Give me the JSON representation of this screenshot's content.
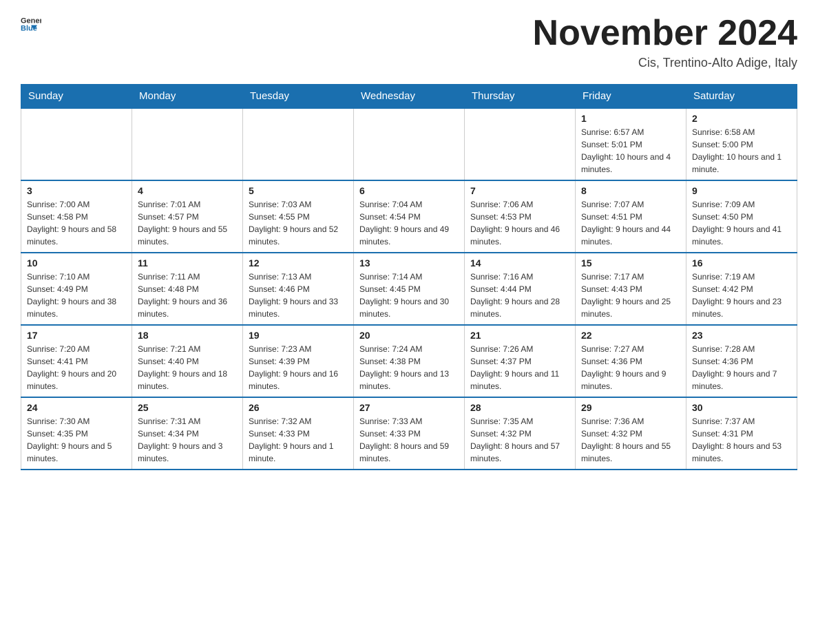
{
  "logo": {
    "text_general": "General",
    "text_blue": "Blue",
    "icon": "▶"
  },
  "header": {
    "month": "November 2024",
    "location": "Cis, Trentino-Alto Adige, Italy"
  },
  "days_of_week": [
    "Sunday",
    "Monday",
    "Tuesday",
    "Wednesday",
    "Thursday",
    "Friday",
    "Saturday"
  ],
  "weeks": [
    [
      {
        "day": "",
        "info": ""
      },
      {
        "day": "",
        "info": ""
      },
      {
        "day": "",
        "info": ""
      },
      {
        "day": "",
        "info": ""
      },
      {
        "day": "",
        "info": ""
      },
      {
        "day": "1",
        "info": "Sunrise: 6:57 AM\nSunset: 5:01 PM\nDaylight: 10 hours and 4 minutes."
      },
      {
        "day": "2",
        "info": "Sunrise: 6:58 AM\nSunset: 5:00 PM\nDaylight: 10 hours and 1 minute."
      }
    ],
    [
      {
        "day": "3",
        "info": "Sunrise: 7:00 AM\nSunset: 4:58 PM\nDaylight: 9 hours and 58 minutes."
      },
      {
        "day": "4",
        "info": "Sunrise: 7:01 AM\nSunset: 4:57 PM\nDaylight: 9 hours and 55 minutes."
      },
      {
        "day": "5",
        "info": "Sunrise: 7:03 AM\nSunset: 4:55 PM\nDaylight: 9 hours and 52 minutes."
      },
      {
        "day": "6",
        "info": "Sunrise: 7:04 AM\nSunset: 4:54 PM\nDaylight: 9 hours and 49 minutes."
      },
      {
        "day": "7",
        "info": "Sunrise: 7:06 AM\nSunset: 4:53 PM\nDaylight: 9 hours and 46 minutes."
      },
      {
        "day": "8",
        "info": "Sunrise: 7:07 AM\nSunset: 4:51 PM\nDaylight: 9 hours and 44 minutes."
      },
      {
        "day": "9",
        "info": "Sunrise: 7:09 AM\nSunset: 4:50 PM\nDaylight: 9 hours and 41 minutes."
      }
    ],
    [
      {
        "day": "10",
        "info": "Sunrise: 7:10 AM\nSunset: 4:49 PM\nDaylight: 9 hours and 38 minutes."
      },
      {
        "day": "11",
        "info": "Sunrise: 7:11 AM\nSunset: 4:48 PM\nDaylight: 9 hours and 36 minutes."
      },
      {
        "day": "12",
        "info": "Sunrise: 7:13 AM\nSunset: 4:46 PM\nDaylight: 9 hours and 33 minutes."
      },
      {
        "day": "13",
        "info": "Sunrise: 7:14 AM\nSunset: 4:45 PM\nDaylight: 9 hours and 30 minutes."
      },
      {
        "day": "14",
        "info": "Sunrise: 7:16 AM\nSunset: 4:44 PM\nDaylight: 9 hours and 28 minutes."
      },
      {
        "day": "15",
        "info": "Sunrise: 7:17 AM\nSunset: 4:43 PM\nDaylight: 9 hours and 25 minutes."
      },
      {
        "day": "16",
        "info": "Sunrise: 7:19 AM\nSunset: 4:42 PM\nDaylight: 9 hours and 23 minutes."
      }
    ],
    [
      {
        "day": "17",
        "info": "Sunrise: 7:20 AM\nSunset: 4:41 PM\nDaylight: 9 hours and 20 minutes."
      },
      {
        "day": "18",
        "info": "Sunrise: 7:21 AM\nSunset: 4:40 PM\nDaylight: 9 hours and 18 minutes."
      },
      {
        "day": "19",
        "info": "Sunrise: 7:23 AM\nSunset: 4:39 PM\nDaylight: 9 hours and 16 minutes."
      },
      {
        "day": "20",
        "info": "Sunrise: 7:24 AM\nSunset: 4:38 PM\nDaylight: 9 hours and 13 minutes."
      },
      {
        "day": "21",
        "info": "Sunrise: 7:26 AM\nSunset: 4:37 PM\nDaylight: 9 hours and 11 minutes."
      },
      {
        "day": "22",
        "info": "Sunrise: 7:27 AM\nSunset: 4:36 PM\nDaylight: 9 hours and 9 minutes."
      },
      {
        "day": "23",
        "info": "Sunrise: 7:28 AM\nSunset: 4:36 PM\nDaylight: 9 hours and 7 minutes."
      }
    ],
    [
      {
        "day": "24",
        "info": "Sunrise: 7:30 AM\nSunset: 4:35 PM\nDaylight: 9 hours and 5 minutes."
      },
      {
        "day": "25",
        "info": "Sunrise: 7:31 AM\nSunset: 4:34 PM\nDaylight: 9 hours and 3 minutes."
      },
      {
        "day": "26",
        "info": "Sunrise: 7:32 AM\nSunset: 4:33 PM\nDaylight: 9 hours and 1 minute."
      },
      {
        "day": "27",
        "info": "Sunrise: 7:33 AM\nSunset: 4:33 PM\nDaylight: 8 hours and 59 minutes."
      },
      {
        "day": "28",
        "info": "Sunrise: 7:35 AM\nSunset: 4:32 PM\nDaylight: 8 hours and 57 minutes."
      },
      {
        "day": "29",
        "info": "Sunrise: 7:36 AM\nSunset: 4:32 PM\nDaylight: 8 hours and 55 minutes."
      },
      {
        "day": "30",
        "info": "Sunrise: 7:37 AM\nSunset: 4:31 PM\nDaylight: 8 hours and 53 minutes."
      }
    ]
  ]
}
